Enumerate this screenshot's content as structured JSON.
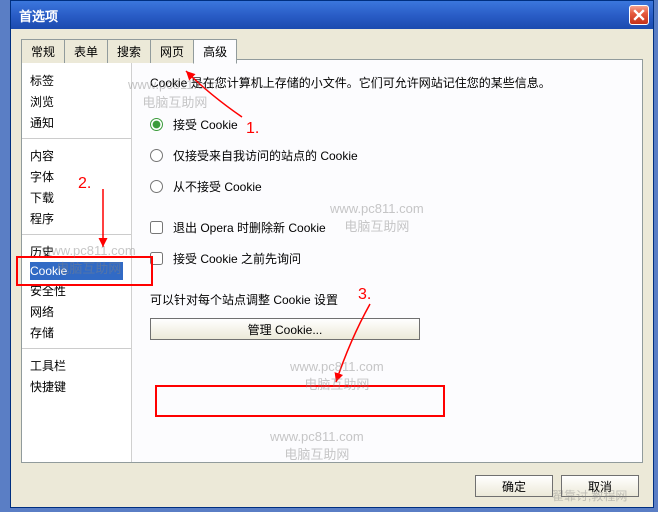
{
  "window": {
    "title": "首选项"
  },
  "tabs": {
    "items": [
      "常规",
      "表单",
      "搜索",
      "网页",
      "高级"
    ],
    "active": 4
  },
  "sidebar": {
    "groups": [
      {
        "items": [
          "标签",
          "浏览",
          "通知"
        ]
      },
      {
        "items": [
          "内容",
          "字体",
          "下载",
          "程序"
        ]
      },
      {
        "items": [
          "历史",
          "Cookie",
          "安全性",
          "网络",
          "存储"
        ]
      },
      {
        "items": [
          "工具栏",
          "快捷键"
        ]
      }
    ],
    "selected": "Cookie"
  },
  "main": {
    "description": "Cookie 是在您计算机上存储的小文件。它们可允许网站记住您的某些信息。",
    "radios": {
      "accept": "接受 Cookie",
      "accept_visited": "仅接受来自我访问的站点的 Cookie",
      "never": "从不接受 Cookie",
      "selected": "accept"
    },
    "checks": {
      "delete_on_exit": "退出 Opera 时删除新 Cookie",
      "ask_before": "接受 Cookie 之前先询问"
    },
    "hint": "可以针对每个站点调整 Cookie 设置",
    "manage_button": "管理 Cookie..."
  },
  "footer": {
    "ok": "确定",
    "cancel": "取消"
  },
  "annotations": {
    "step1": "1.",
    "step2": "2.",
    "step3": "3."
  },
  "watermark": {
    "line1": "www.pc811.com",
    "line2": "电脑互助网"
  },
  "bottom_corner": "翟靠讨,教程网"
}
